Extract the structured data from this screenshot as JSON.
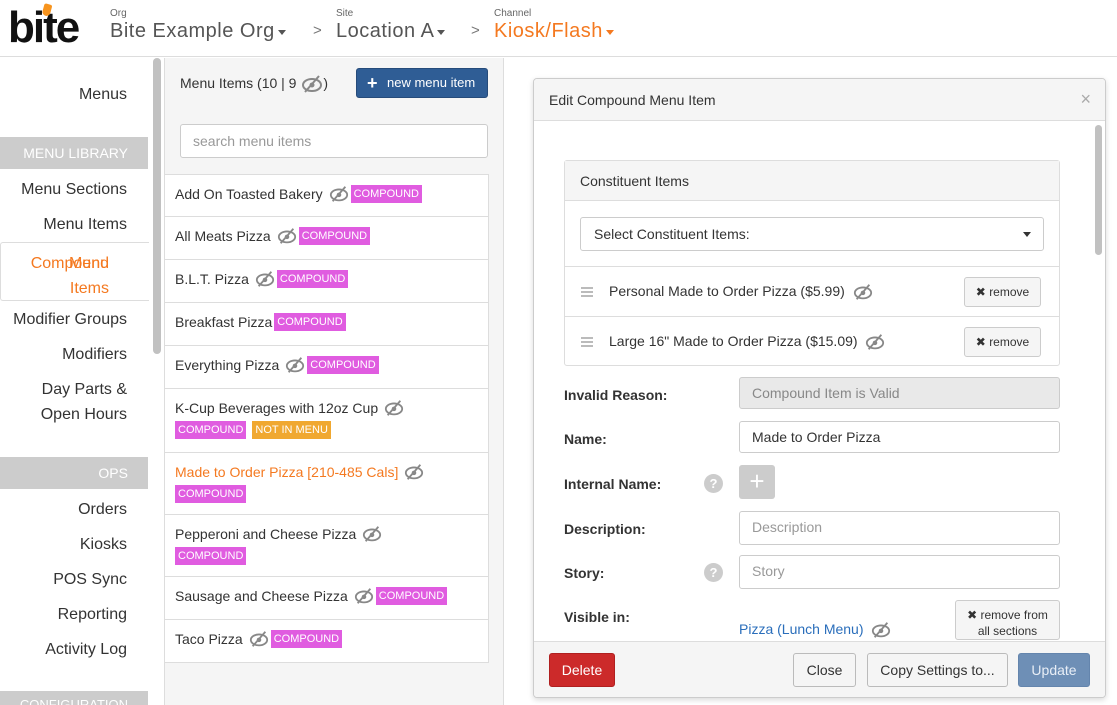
{
  "header": {
    "logo": "bite",
    "org_label": "Org",
    "org_value": "Bite Example Org",
    "site_label": "Site",
    "site_value": "Location A",
    "channel_label": "Channel",
    "channel_value": "Kiosk/Flash",
    "separator": ">"
  },
  "sidebar": {
    "items": [
      {
        "label": "Menus"
      },
      {
        "label": "Menu Sections"
      },
      {
        "label": "Menu Items"
      },
      {
        "label": "Compound Menu Items"
      },
      {
        "label": "Modifier Groups"
      },
      {
        "label": "Modifiers"
      },
      {
        "label": "Day Parts & Open Hours"
      },
      {
        "label": "Orders"
      },
      {
        "label": "Kiosks"
      },
      {
        "label": "POS Sync"
      },
      {
        "label": "Reporting"
      },
      {
        "label": "Activity Log"
      }
    ],
    "compound_line1": "Compound",
    "compound_line2": "Menu Items",
    "dayparts_line1": "Day Parts &",
    "dayparts_line2": "Open Hours",
    "section_library": "MENU LIBRARY",
    "section_ops": "OPS",
    "section_config": "CONFIGURATION"
  },
  "list_panel": {
    "title": "Menu Items (10 | 9",
    "title_suffix": ")",
    "new_button": "new menu item",
    "search_placeholder": "search menu items",
    "items": [
      {
        "name": "Add On Toasted Bakery",
        "hidden_icon": true,
        "badges": [
          "COMPOUND"
        ]
      },
      {
        "name": "All Meats Pizza",
        "hidden_icon": true,
        "badges": [
          "COMPOUND"
        ]
      },
      {
        "name": "B.L.T. Pizza",
        "hidden_icon": true,
        "badges": [
          "COMPOUND"
        ]
      },
      {
        "name": "Breakfast Pizza",
        "hidden_icon": false,
        "badges": [
          "COMPOUND"
        ]
      },
      {
        "name": "Everything Pizza",
        "hidden_icon": true,
        "badges": [
          "COMPOUND"
        ]
      },
      {
        "name": "K-Cup Beverages with 12oz Cup",
        "hidden_icon": true,
        "badges": [
          "COMPOUND",
          "NOT IN MENU"
        ]
      },
      {
        "name": "Made to Order Pizza [210-485 Cals]",
        "hidden_icon": true,
        "badges": [
          "COMPOUND"
        ],
        "selected": true
      },
      {
        "name": "Pepperoni and Cheese Pizza",
        "hidden_icon": true,
        "badges": [
          "COMPOUND"
        ]
      },
      {
        "name": "Sausage and Cheese Pizza",
        "hidden_icon": true,
        "badges": [
          "COMPOUND"
        ]
      },
      {
        "name": "Taco Pizza",
        "hidden_icon": true,
        "badges": [
          "COMPOUND"
        ]
      }
    ]
  },
  "modal": {
    "title": "Edit Compound Menu Item",
    "close_glyph": "×",
    "constituent_title": "Constituent Items",
    "constituent_select": "Select Constituent Items:",
    "constituents": [
      {
        "name": "Personal Made to Order Pizza ($5.99)",
        "remove": "remove"
      },
      {
        "name": "Large 16\" Made to Order Pizza ($15.09)",
        "remove": "remove"
      }
    ],
    "invalid_reason_label": "Invalid Reason:",
    "invalid_reason_value": "Compound Item is Valid",
    "name_label": "Name:",
    "name_value": "Made to Order Pizza",
    "internal_name_label": "Internal Name:",
    "description_label": "Description:",
    "description_placeholder": "Description",
    "story_label": "Story:",
    "story_placeholder": "Story",
    "visible_in_label": "Visible in:",
    "visible_in_link": "Pizza (Lunch Menu)",
    "remove_all_line1": "remove from",
    "remove_all_line2": "all sections",
    "help_glyph": "?",
    "plus_glyph": "+",
    "remove_glyph": "✖",
    "buttons": {
      "delete": "Delete",
      "close": "Close",
      "copy": "Copy Settings to...",
      "update": "Update"
    }
  },
  "colors": {
    "accent_orange": "#f47920",
    "compound_badge": "#e05ce0",
    "not_in_menu_badge": "#f0a830",
    "primary_button": "#2f5d95",
    "delete_button": "#cc2a2a",
    "update_button": "#6e8fb6"
  }
}
